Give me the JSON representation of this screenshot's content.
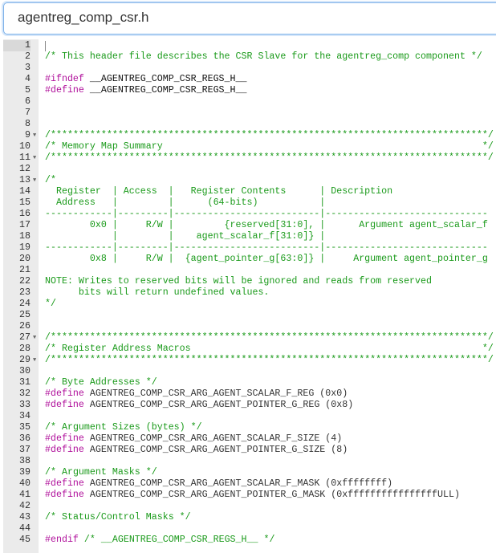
{
  "title": "agentreg_comp_csr.h",
  "editor": {
    "active_line": 1,
    "fold_lines": [
      9,
      11,
      13,
      27,
      29
    ],
    "lines": [
      "",
      "/* This header file describes the CSR Slave for the agentreg_comp component */",
      "",
      "#ifndef __AGENTREG_COMP_CSR_REGS_H__",
      "#define __AGENTREG_COMP_CSR_REGS_H__",
      "",
      "",
      "",
      "/******************************************************************************/",
      "/* Memory Map Summary                                                         */",
      "/******************************************************************************/",
      "",
      "/*",
      "  Register  | Access  |   Register Contents      | Description",
      "  Address   |         |      (64-bits)           |",
      "------------|---------|--------------------------|-----------------------------",
      "        0x0 |     R/W |         {reserved[31:0], |      Argument agent_scalar_f",
      "            |         |    agent_scalar_f[31:0]} |",
      "------------|---------|--------------------------|-----------------------------",
      "        0x8 |     R/W |  {agent_pointer_g[63:0]} |     Argument agent_pointer_g",
      "",
      "NOTE: Writes to reserved bits will be ignored and reads from reserved",
      "      bits will return undefined values.",
      "*/",
      "",
      "",
      "/******************************************************************************/",
      "/* Register Address Macros                                                    */",
      "/******************************************************************************/",
      "",
      "/* Byte Addresses */",
      "#define AGENTREG_COMP_CSR_ARG_AGENT_SCALAR_F_REG (0x0)",
      "#define AGENTREG_COMP_CSR_ARG_AGENT_POINTER_G_REG (0x8)",
      "",
      "/* Argument Sizes (bytes) */",
      "#define AGENTREG_COMP_CSR_ARG_AGENT_SCALAR_F_SIZE (4)",
      "#define AGENTREG_COMP_CSR_ARG_AGENT_POINTER_G_SIZE (8)",
      "",
      "/* Argument Masks */",
      "#define AGENTREG_COMP_CSR_ARG_AGENT_SCALAR_F_MASK (0xffffffff)",
      "#define AGENTREG_COMP_CSR_ARG_AGENT_POINTER_G_MASK (0xffffffffffffffffULL)",
      "",
      "/* Status/Control Masks */",
      "",
      "#endif /* __AGENTREG_COMP_CSR_REGS_H__ */"
    ]
  },
  "colors": {
    "comment": "#1a9a1a",
    "preprocessor": "#b0109b",
    "focus_border": "#7fb2e8"
  }
}
